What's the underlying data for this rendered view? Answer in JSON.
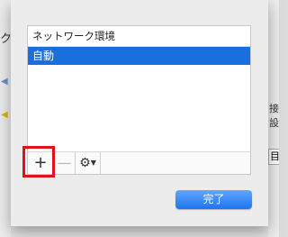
{
  "background": {
    "left_char": "ク",
    "right_line1": "接",
    "right_line2": "設",
    "right_box": "目"
  },
  "list": {
    "header": "ネットワーク環境",
    "items": [
      "自動"
    ],
    "selected_index": 0
  },
  "toolbar": {
    "add_label": "+",
    "remove_label": "—",
    "gear_icon": "gear-icon"
  },
  "buttons": {
    "done_label": "完了"
  },
  "colors": {
    "selection": "#1a6fde",
    "primary_button": "#1d74f0",
    "highlight": "#e0111b"
  }
}
